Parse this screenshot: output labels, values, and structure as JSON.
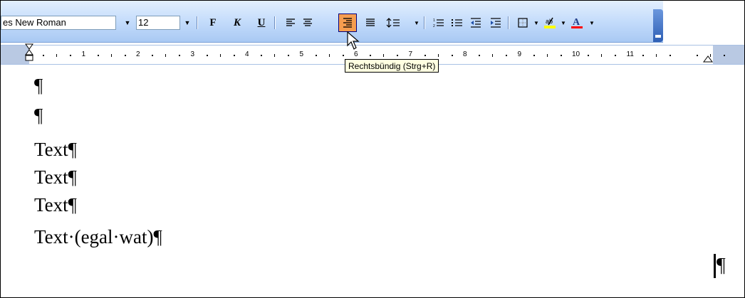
{
  "toolbar": {
    "font_name": "es New Roman",
    "font_size": "12",
    "bold_label": "F",
    "italic_label": "K",
    "underline_label": "U"
  },
  "ruler": {
    "numbers": [
      "1",
      "2",
      "3",
      "4",
      "5",
      "6",
      "7",
      "8",
      "9",
      "10",
      "11"
    ]
  },
  "tooltip": {
    "text": "Rechtsbündig (Strg+R)"
  },
  "document": {
    "paragraphs": [
      "¶",
      "¶",
      "Text¶",
      "Text¶",
      "Text¶",
      "Text·(egal·wat)¶"
    ],
    "end_mark": "¶"
  },
  "colors": {
    "toolbar_bg": "#c4dcfb",
    "active_button": "#f59d4f",
    "highlight": "#ffff00",
    "font_color_bar": "#ff0000",
    "tooltip_bg": "#ffffe1"
  },
  "icons": [
    "align-left-icon",
    "align-center-icon",
    "align-right-icon",
    "justify-icon",
    "line-spacing-icon",
    "numbering-icon",
    "bullets-icon",
    "decrease-indent-icon",
    "increase-indent-icon",
    "border-icon",
    "highlight-icon",
    "font-color-icon",
    "toolbar-options-icon",
    "mouse-pointer-icon"
  ]
}
